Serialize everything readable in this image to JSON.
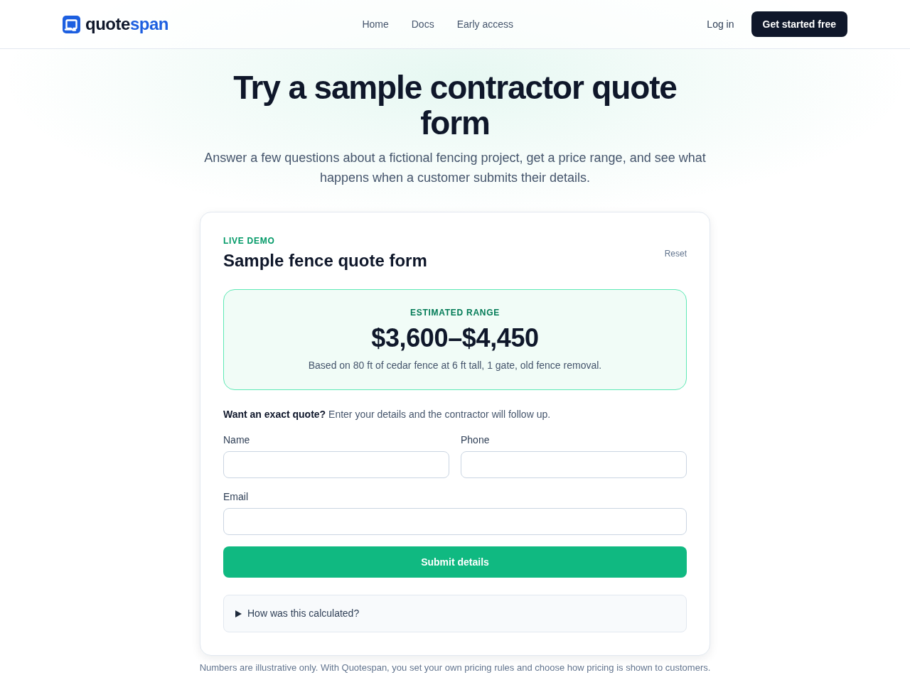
{
  "header": {
    "logo": {
      "text": "quote",
      "accent": "span"
    },
    "nav": [
      "Home",
      "Docs",
      "Early access"
    ],
    "login": "Log in",
    "cta": "Get started free"
  },
  "hero": {
    "title": "Try a sample contractor quote form",
    "subtitle": "Answer a few questions about a fictional fencing project, get a price range, and see what happens when a customer submits their details."
  },
  "demo_card": {
    "eyebrow": "LIVE DEMO",
    "title": "Sample fence quote form",
    "reset": "Reset",
    "estimate": {
      "label": "ESTIMATED RANGE",
      "price": "$3,600–$4,450",
      "basis": "Based on 80 ft of cedar fence at 6 ft tall, 1 gate, old fence removal."
    },
    "prompt": "**Want an exact quote?** Enter your details and the contractor will follow up.",
    "field_rows": [
      [
        {
          "label": "Name"
        },
        {
          "label": "Phone"
        }
      ],
      [
        {
          "label": "Email"
        }
      ]
    ],
    "submit": "Submit details",
    "disclosure": {
      "label": "How was this calculated?",
      "expanded": false
    }
  },
  "footnote": "Numbers are illustrative only. With Quotespan, you set your own pricing rules and choose how pricing is shown to customers."
}
